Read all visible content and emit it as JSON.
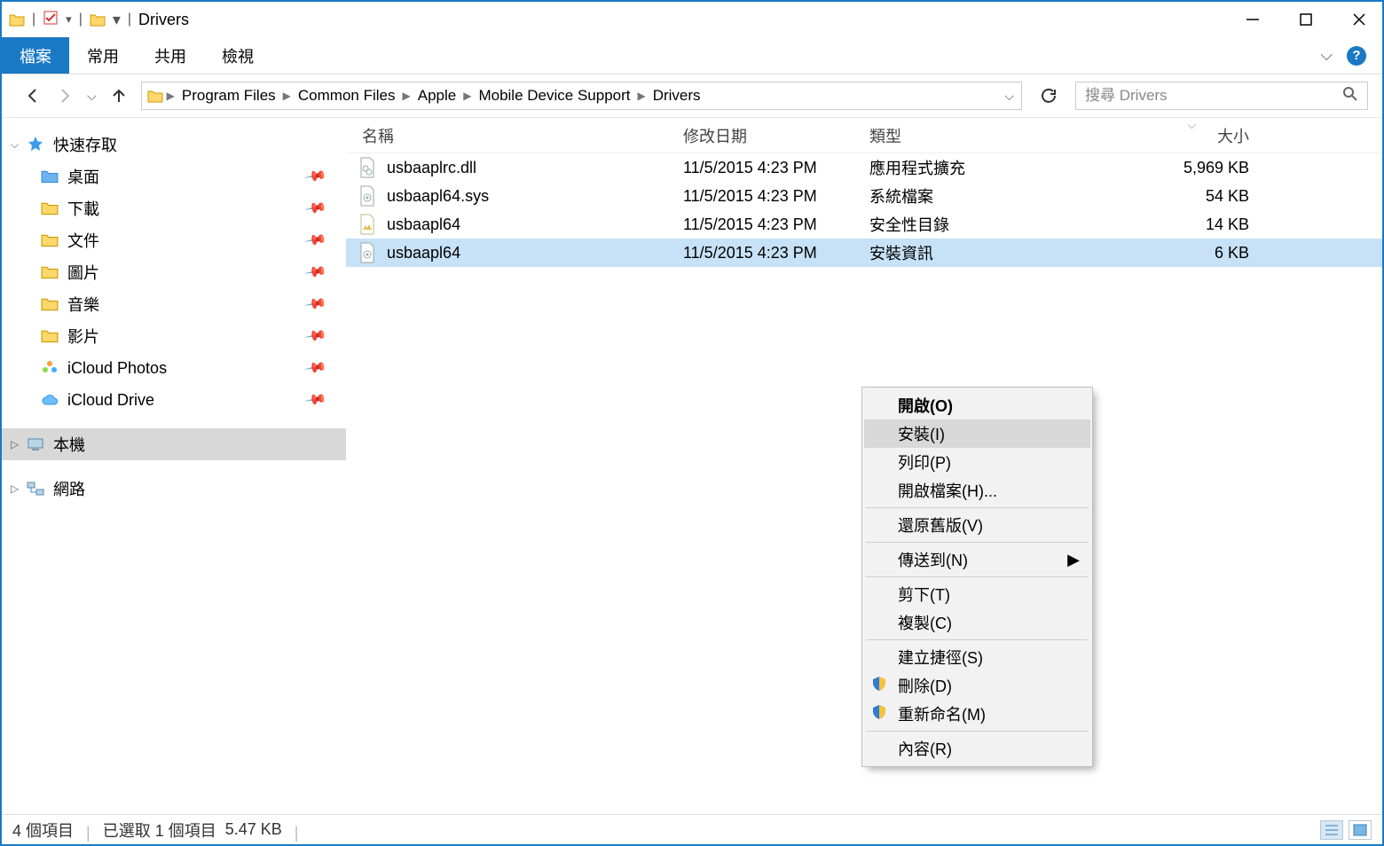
{
  "title": "Drivers",
  "ribbon": {
    "tabs": [
      "檔案",
      "常用",
      "共用",
      "檢視"
    ]
  },
  "breadcrumb": [
    "Program Files",
    "Common Files",
    "Apple",
    "Mobile Device Support",
    "Drivers"
  ],
  "search_placeholder": "搜尋 Drivers",
  "sidebar": {
    "quick_access": "快速存取",
    "items": [
      "桌面",
      "下載",
      "文件",
      "圖片",
      "音樂",
      "影片",
      "iCloud Photos",
      "iCloud Drive"
    ],
    "this_pc": "本機",
    "network": "網路"
  },
  "columns": {
    "name": "名稱",
    "date": "修改日期",
    "type": "類型",
    "size": "大小"
  },
  "files": [
    {
      "name": "usbaaplrc.dll",
      "date": "11/5/2015 4:23 PM",
      "type": "應用程式擴充",
      "size": "5,969 KB",
      "sel": false,
      "icon": "dll"
    },
    {
      "name": "usbaapl64.sys",
      "date": "11/5/2015 4:23 PM",
      "type": "系統檔案",
      "size": "54 KB",
      "sel": false,
      "icon": "sys"
    },
    {
      "name": "usbaapl64",
      "date": "11/5/2015 4:23 PM",
      "type": "安全性目錄",
      "size": "14 KB",
      "sel": false,
      "icon": "cat"
    },
    {
      "name": "usbaapl64",
      "date": "11/5/2015 4:23 PM",
      "type": "安裝資訊",
      "size": "6 KB",
      "sel": true,
      "icon": "inf"
    }
  ],
  "context_menu": {
    "open": "開啟(O)",
    "install": "安裝(I)",
    "print": "列印(P)",
    "open_with": "開啟檔案(H)...",
    "restore": "還原舊版(V)",
    "send_to": "傳送到(N)",
    "cut": "剪下(T)",
    "copy": "複製(C)",
    "shortcut": "建立捷徑(S)",
    "delete": "刪除(D)",
    "rename": "重新命名(M)",
    "properties": "內容(R)"
  },
  "status": {
    "count": "4 個項目",
    "selected": "已選取 1 個項目",
    "size": "5.47 KB"
  }
}
